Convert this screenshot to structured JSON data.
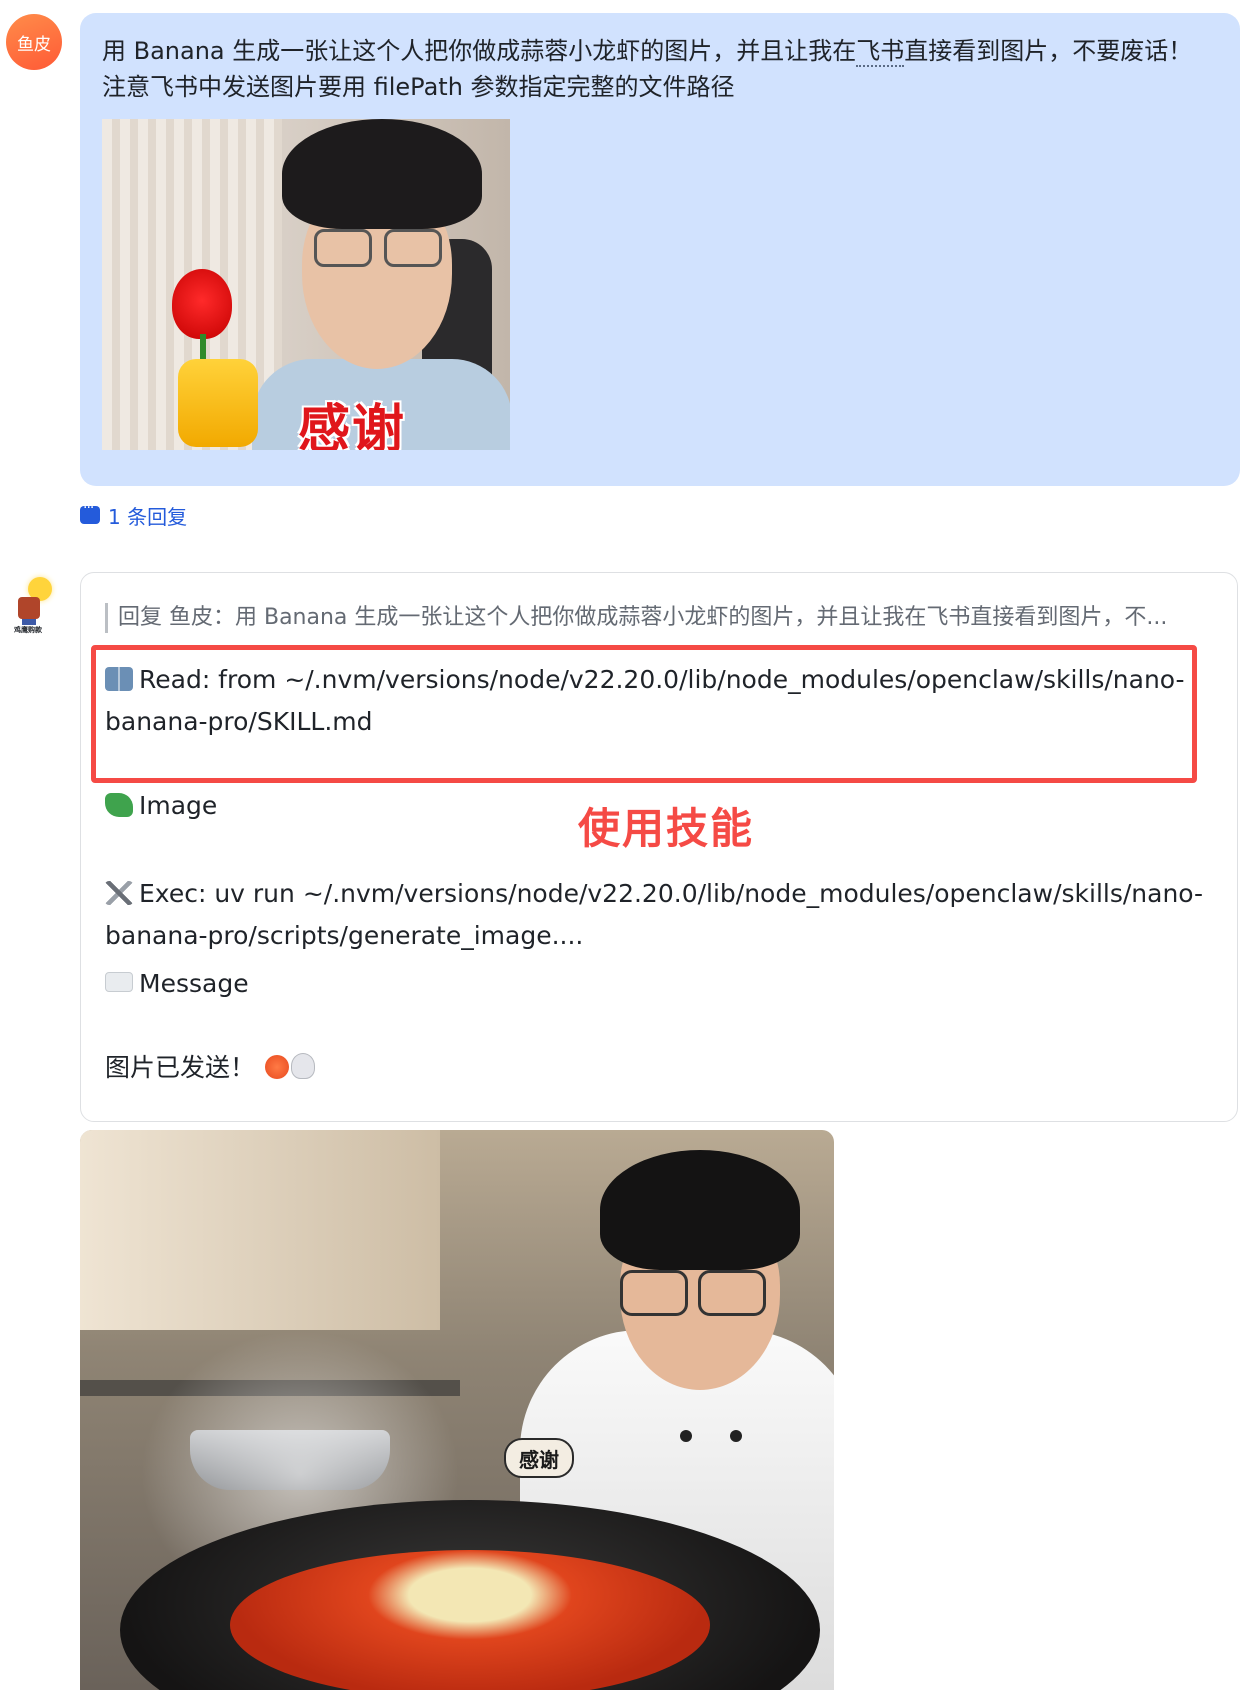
{
  "user_message": {
    "avatar_text": "鱼皮",
    "line1_before": "用 Banana 生成一张让这个人把你做成蒜蓉小龙虾的图片，并且让我在",
    "line1_dotted": "飞书",
    "line1_after": "直接看到图片，不要废话！",
    "line2": "注意飞书中发送图片要用 filePath 参数指定完整的文件路径",
    "photo_caption": "感谢"
  },
  "reply_count_label": "1 条回复",
  "bot_message": {
    "avatar_label": "鸡鹰购款",
    "quote": "回复 鱼皮：用 Banana 生成一张让这个人把你做成蒜蓉小龙虾的图片，并且让我在飞书直接看到图片，不...",
    "read_line": "Read: from ~/.nvm/versions/node/v22.20.0/lib/node_modules/openclaw/skills/nano-banana-pro/SKILL.md",
    "image_line": "Image",
    "exec_line": "Exec: uv run ~/.nvm/versions/node/v22.20.0/lib/node_modules/openclaw/skills/nano-banana-pro/scripts/generate_image....",
    "message_line": "Message",
    "done_line": "图片已发送！",
    "icons": [
      "book-icon",
      "puzzle-icon",
      "tools-icon",
      "envelope-icon",
      "shrimp-icon",
      "skull-icon"
    ]
  },
  "annotation": "使用技能",
  "generated_photo_caption": "感谢",
  "colors": {
    "user_bubble": "#d1e2fe",
    "link_blue": "#245bdb",
    "highlight_red": "#f54a45"
  }
}
